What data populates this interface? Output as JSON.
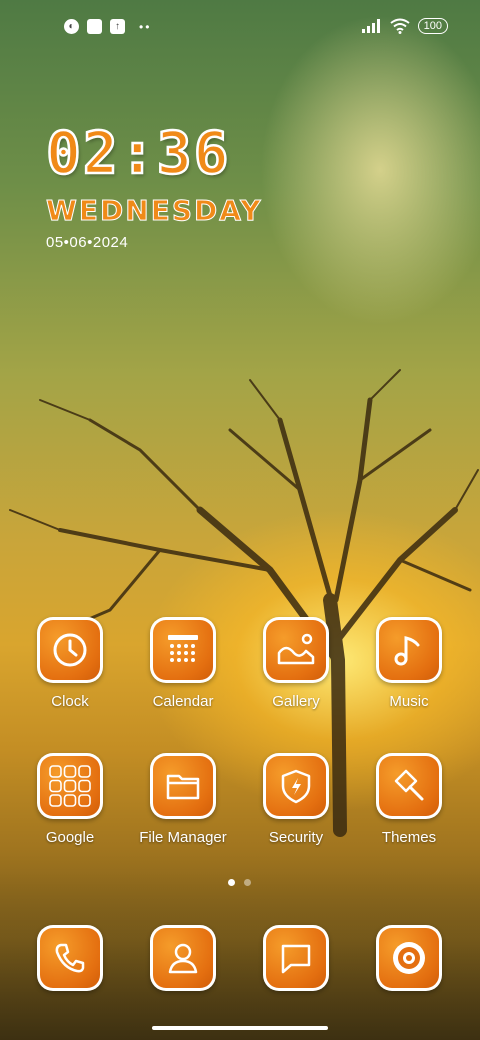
{
  "status_bar": {
    "left_icons": [
      "notification-icon",
      "square-icon",
      "upload-icon"
    ],
    "more_dots": "••",
    "battery": "100",
    "right_icons": [
      "signal-icon",
      "wifi-icon",
      "battery-icon"
    ]
  },
  "clock_widget": {
    "time": "02:36",
    "day": "WEDNESDAY",
    "date": "05•06•2024"
  },
  "apps_row1": [
    {
      "label": "Clock",
      "icon": "clock-icon"
    },
    {
      "label": "Calendar",
      "icon": "calendar-icon"
    },
    {
      "label": "Gallery",
      "icon": "gallery-icon"
    },
    {
      "label": "Music",
      "icon": "music-icon"
    }
  ],
  "apps_row2": [
    {
      "label": "Google",
      "icon": "google-folder-icon"
    },
    {
      "label": "File Manager",
      "icon": "folder-icon"
    },
    {
      "label": "Security",
      "icon": "shield-icon"
    },
    {
      "label": "Themes",
      "icon": "brush-icon"
    }
  ],
  "dock": [
    {
      "icon": "phone-icon"
    },
    {
      "icon": "contacts-icon"
    },
    {
      "icon": "messages-icon"
    },
    {
      "icon": "browser-icon"
    }
  ],
  "page_indicator": {
    "count": 2,
    "active": 1
  },
  "colors": {
    "accent": "#e8751a",
    "text": "#ffffff"
  }
}
